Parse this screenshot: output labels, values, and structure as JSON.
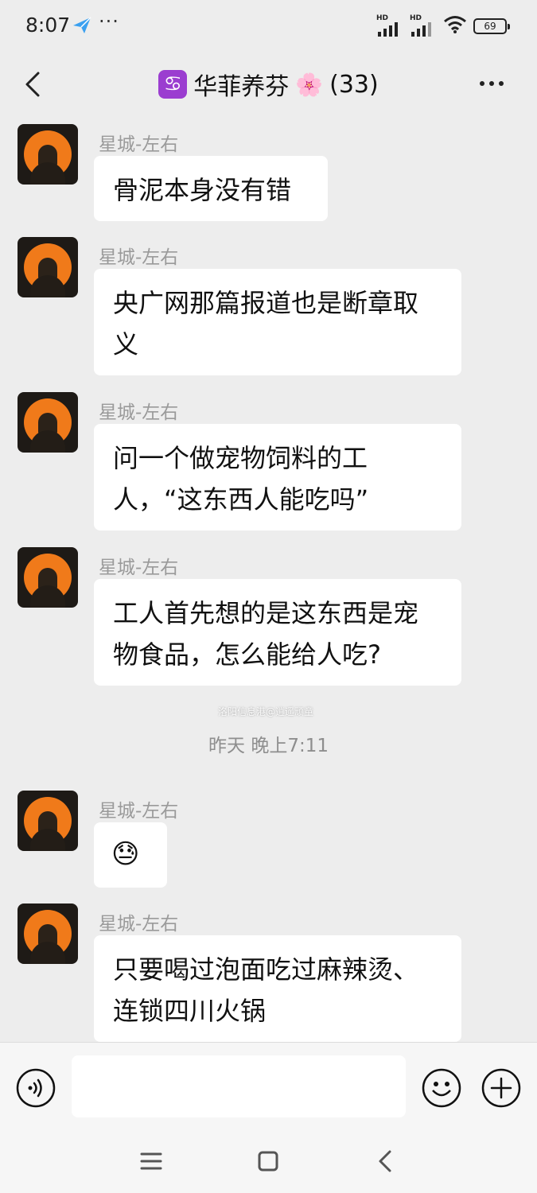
{
  "status_bar": {
    "time": "8:07",
    "app_icon": "paper-plane-icon",
    "more": "···",
    "network_1": "HD",
    "network_2": "HD",
    "battery": "69"
  },
  "header": {
    "badge_glyph": "♋",
    "title": "华菲养芬",
    "flower": "🌸",
    "count": "(33)",
    "back_icon": "chevron-left-icon",
    "more_icon": "more-dots-icon"
  },
  "messages": [
    {
      "sender": "星城-左右",
      "text": "骨泥本身没有错"
    },
    {
      "sender": "星城-左右",
      "text": "央广网那篇报道也是断章取义"
    },
    {
      "sender": "星城-左右",
      "text": "问一个做宠物饲料的工人，“这东西人能吃吗”"
    },
    {
      "sender": "星城-左右",
      "text": "工人首先想的是这东西是宠物食品，怎么能给人吃?"
    },
    {
      "sender": "星城-左右",
      "text": "😓"
    },
    {
      "sender": "星城-左右",
      "text": "只要喝过泡面吃过麻辣烫、连锁四川火锅"
    }
  ],
  "time_separator": "昨天 晚上7:11",
  "watermark": "洛阳信息港@逍遥顽童",
  "input_bar": {
    "voice_icon": "voice-icon",
    "emoji_icon": "emoji-icon",
    "plus_icon": "plus-icon",
    "input_value": ""
  },
  "nav_bar": {
    "menu_icon": "menu-icon",
    "home_icon": "home-icon",
    "back_icon": "back-icon"
  }
}
